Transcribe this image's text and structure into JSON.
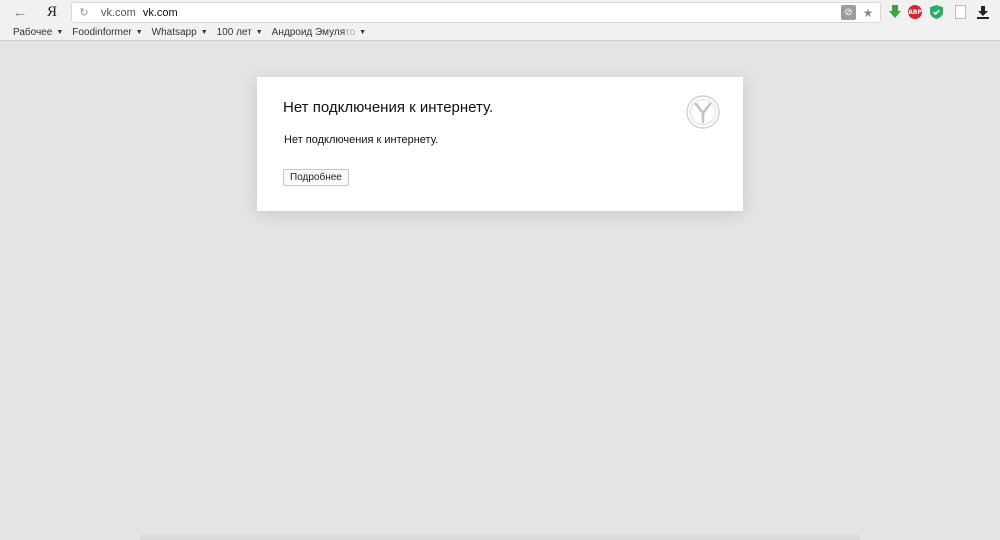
{
  "toolbar": {
    "back_icon": "back-arrow-icon",
    "browser_logo": "Я",
    "reload_icon": "reload-icon",
    "host": "vk.com",
    "domain": "vk.com",
    "protocol_icon": "protect-icon",
    "star_icon": "star-icon",
    "extensions": [
      {
        "name": "download-arrow-icon",
        "color": "#3aa33d"
      },
      {
        "name": "adblock-icon",
        "label": "ABP",
        "color": "#d7262e"
      },
      {
        "name": "shield-icon",
        "color": "#23b25f"
      },
      {
        "name": "page-icon"
      },
      {
        "name": "downloads-icon",
        "color": "#222222"
      }
    ]
  },
  "bookmarks": [
    {
      "label": "Рабочее"
    },
    {
      "label": "Foodinformer"
    },
    {
      "label": "Whatsapp"
    },
    {
      "label": "100 лет"
    },
    {
      "label": "Андроид Эмуля",
      "faded": "то"
    }
  ],
  "error": {
    "title": "Нет подключения к интернету.",
    "message": "Нет подключения к интернету.",
    "button_label": "Подробнее",
    "logo": "yandex-browser-logo-icon"
  },
  "colors": {
    "page_background": "#e4e4e4",
    "card_background": "#ffffff",
    "chrome_background": "#f1f1f1"
  }
}
